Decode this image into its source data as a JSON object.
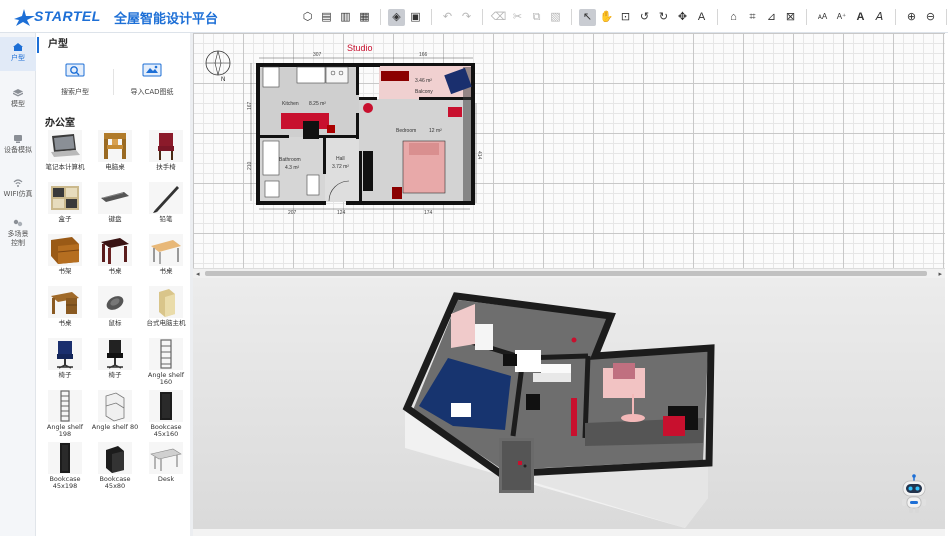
{
  "app": {
    "logo_text": "STARTEL",
    "title": "全屋智能设计平台"
  },
  "toolbar": {
    "groups": [
      [
        "cube-icon",
        "doc-icon",
        "doc-add-icon",
        "doc-copy-icon"
      ],
      [
        "layer-3d-icon",
        "layer-2d-icon"
      ],
      [
        "undo-icon",
        "redo-icon"
      ],
      [
        "cut-icon",
        "scissors-icon",
        "copy-icon",
        "paste-icon"
      ],
      [
        "pointer-icon",
        "hand-icon",
        "add-wall-icon",
        "rotate-left-icon",
        "rotate-right-icon",
        "move-icon",
        "add-text-icon"
      ],
      [
        "create-room-icon",
        "create-polyline-icon",
        "create-dimension-icon",
        "create-label-icon"
      ],
      [
        "text-size-icon",
        "text-increase-icon",
        "text-bold-icon",
        "text-italic-icon"
      ],
      [
        "zoom-in-icon",
        "zoom-out-icon"
      ],
      [
        "settings-tools-icon"
      ]
    ]
  },
  "leftnav": {
    "items": [
      {
        "label": "户型",
        "icon": "house-icon",
        "active": true
      },
      {
        "label": "模型",
        "icon": "model-icon",
        "active": false
      },
      {
        "label": "设备模拟",
        "icon": "device-icon",
        "active": false
      },
      {
        "label": "WIFI仿真",
        "icon": "wifi-icon",
        "active": false
      },
      {
        "label": "多场景控制",
        "icon": "scene-icon",
        "active": false
      }
    ]
  },
  "catalog": {
    "section_title": "户型",
    "search_floorplan": "搜索户型",
    "import_cad": "导入CAD图纸",
    "category_title": "办公室",
    "items": [
      {
        "label": "笔记本计算机",
        "icon": "laptop-icon"
      },
      {
        "label": "电脑桌",
        "icon": "computer-desk-icon"
      },
      {
        "label": "扶手椅",
        "icon": "armchair-icon"
      },
      {
        "label": "盒子",
        "icon": "box-shelf-icon"
      },
      {
        "label": "键盘",
        "icon": "keyboard-icon"
      },
      {
        "label": "铅笔",
        "icon": "pencil-icon"
      },
      {
        "label": "书架",
        "icon": "bookshelf-icon"
      },
      {
        "label": "书桌",
        "icon": "desk-dark-icon"
      },
      {
        "label": "书桌",
        "icon": "desk-light-icon"
      },
      {
        "label": "书桌",
        "icon": "desk-drawer-icon"
      },
      {
        "label": "鼠标",
        "icon": "mouse-icon"
      },
      {
        "label": "台式电脑主机",
        "icon": "pc-tower-icon"
      },
      {
        "label": "椅子",
        "icon": "office-chair-blue-icon"
      },
      {
        "label": "椅子",
        "icon": "office-chair-black-icon"
      },
      {
        "label": "Angle shelf 160",
        "icon": "angle-shelf-160-icon"
      },
      {
        "label": "Angle shelf 198",
        "icon": "angle-shelf-198-icon"
      },
      {
        "label": "Angle shelf 80",
        "icon": "angle-shelf-80-icon"
      },
      {
        "label": "Bookcase 45x160",
        "icon": "bookcase-45x160-icon"
      },
      {
        "label": "Bookcase 45x198",
        "icon": "bookcase-45x198-icon"
      },
      {
        "label": "Bookcase 45x80",
        "icon": "bookcase-45x80-icon"
      },
      {
        "label": "Desk",
        "icon": "desk-icon"
      }
    ]
  },
  "plan": {
    "title": "Studio",
    "compass_label": "N",
    "rooms": [
      {
        "name": "Kitchen",
        "area": "8.25 m²"
      },
      {
        "name": "Bathroom",
        "area": "4.3 m²"
      },
      {
        "name": "Hall",
        "area": "3.72 m²"
      },
      {
        "name": "Bedroom",
        "area": "12 m²"
      },
      {
        "name": "Balcony",
        "area": "3.46 m²"
      }
    ],
    "dims": {
      "top_left": "307",
      "top_right": "166",
      "bottom_1": "207",
      "bottom_2": "124",
      "bottom_3": "174",
      "left_1": "167",
      "left_2": "210",
      "right": "414"
    }
  },
  "colors": {
    "brand": "#1d6fd6",
    "accent_red": "#c8102e",
    "wall": "#111111",
    "floor": "#cfcfcf"
  }
}
